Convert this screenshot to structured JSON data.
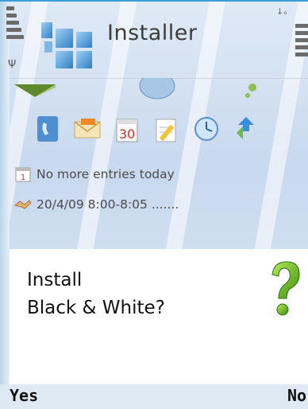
{
  "app": {
    "title": "Installer",
    "status_indicator": "↓ₒ",
    "antenna": "Ψ"
  },
  "shortcuts": [
    {
      "icon": "contacts-icon"
    },
    {
      "icon": "messaging-icon"
    },
    {
      "icon": "calendar-icon",
      "label": "30"
    },
    {
      "icon": "notes-icon"
    },
    {
      "icon": "clock-icon"
    },
    {
      "icon": "connectivity-icon"
    }
  ],
  "calendar": {
    "entry1": "No more entries today",
    "entry2": "20/4/09 8:00-8:05 ......."
  },
  "dialog": {
    "line1": "Install",
    "line2": "Black & White?",
    "icon": "question-mark-icon"
  },
  "softkeys": {
    "left": "Yes",
    "right": "No"
  },
  "colors": {
    "accent": "#3a9fd8",
    "question_green": "#6fbf1a"
  }
}
